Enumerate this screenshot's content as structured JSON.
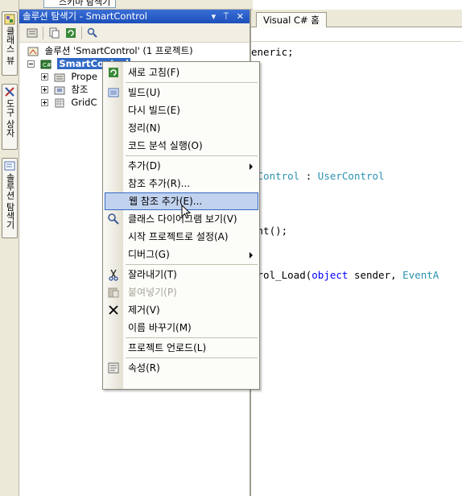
{
  "top_tab": {
    "label": "스키마 탐색기"
  },
  "side_tabs": [
    {
      "label": "클래스 뷰",
      "icon": "class-view-icon"
    },
    {
      "label": "도구 상자",
      "icon": "toolbox-icon"
    },
    {
      "label": "솔루션 탐색기",
      "icon": "solution-explorer-icon"
    }
  ],
  "solution_explorer": {
    "title": "솔루션 탐색기 - SmartControl",
    "title_buttons": "▾ ⍑ ✕",
    "tree": {
      "solution": "솔루션 'SmartControl' (1 프로젝트)",
      "project": "SmartControl",
      "children": [
        "Prope",
        "참조",
        "GridC"
      ]
    }
  },
  "editor": {
    "tab_label": "Visual C# 홈",
    "lines": [
      {
        "parts": [
          {
            "t": "eneric;",
            "c": ""
          }
        ]
      },
      {
        "parts": [
          {
            "t": "dControl",
            "c": "ty"
          },
          {
            "t": " : ",
            "c": ""
          },
          {
            "t": "UserControl",
            "c": "ty"
          }
        ]
      },
      {
        "parts": [
          {
            "t": "ent();",
            "c": ""
          }
        ]
      },
      {
        "parts": [
          {
            "t": "trol_Load(",
            "c": ""
          },
          {
            "t": "object",
            "c": "kw"
          },
          {
            "t": " sender, ",
            "c": ""
          },
          {
            "t": "EventA",
            "c": "ty"
          }
        ]
      }
    ]
  },
  "context_menu": {
    "items": [
      {
        "label": "새로 고침(F)",
        "icon": "refresh-icon"
      },
      {
        "sep": true
      },
      {
        "label": "빌드(U)",
        "icon": "build-icon"
      },
      {
        "label": "다시 빌드(E)"
      },
      {
        "label": "정리(N)"
      },
      {
        "label": "코드 분석 실행(O)"
      },
      {
        "sep": true
      },
      {
        "label": "추가(D)",
        "submenu": true
      },
      {
        "label": "참조 추가(R)..."
      },
      {
        "label": "웹 참조 추가(E)...",
        "hover": true
      },
      {
        "label": "클래스 다이어그램 보기(V)",
        "icon": "class-diagram-icon"
      },
      {
        "label": "시작 프로젝트로 설정(A)"
      },
      {
        "label": "디버그(G)",
        "submenu": true
      },
      {
        "sep": true
      },
      {
        "label": "잘라내기(T)",
        "icon": "cut-icon"
      },
      {
        "label": "붙여넣기(P)",
        "icon": "paste-icon",
        "disabled": true
      },
      {
        "label": "제거(V)",
        "icon": "delete-icon"
      },
      {
        "label": "이름 바꾸기(M)"
      },
      {
        "sep": true
      },
      {
        "label": "프로젝트 언로드(L)"
      },
      {
        "sep": true
      },
      {
        "label": "속성(R)",
        "icon": "properties-icon"
      }
    ]
  },
  "colors": {
    "title_bar": "#1c4fb8",
    "selection": "#316ac5",
    "menu_hover": "#c1d2ee",
    "type_color": "#2b91af",
    "keyword_color": "#0000ff"
  }
}
